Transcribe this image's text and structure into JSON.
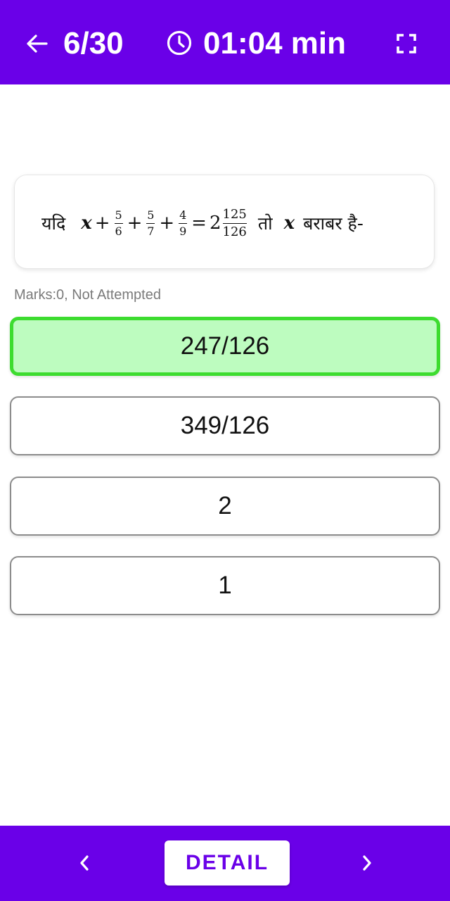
{
  "header": {
    "counter": "6/30",
    "timer": "01:04 min",
    "icons": {
      "back": "arrow-left-icon",
      "clock": "clock-icon",
      "fullscreen": "fullscreen-icon"
    }
  },
  "question": {
    "prefix": "यदि",
    "variable": "x",
    "frac1": {
      "num": "5",
      "den": "6"
    },
    "frac2": {
      "num": "5",
      "den": "7"
    },
    "frac3": {
      "num": "4",
      "den": "9"
    },
    "whole": "2",
    "mixed_frac": {
      "num": "125",
      "den": "126"
    },
    "middle": "तो",
    "suffix": "बराबर है-"
  },
  "status": {
    "marks": "Marks:0, Not Attempted"
  },
  "options": [
    {
      "label": "247/126",
      "state": "correct"
    },
    {
      "label": "349/126",
      "state": "default"
    },
    {
      "label": "2",
      "state": "default"
    },
    {
      "label": "1",
      "state": "default"
    }
  ],
  "footer": {
    "detail_label": "DETAIL",
    "icons": {
      "prev": "chevron-left-icon",
      "next": "chevron-right-icon"
    }
  },
  "colors": {
    "primary": "#6a00e8",
    "correct_fill": "#bdfcbf",
    "correct_border": "#3ddc2f"
  }
}
